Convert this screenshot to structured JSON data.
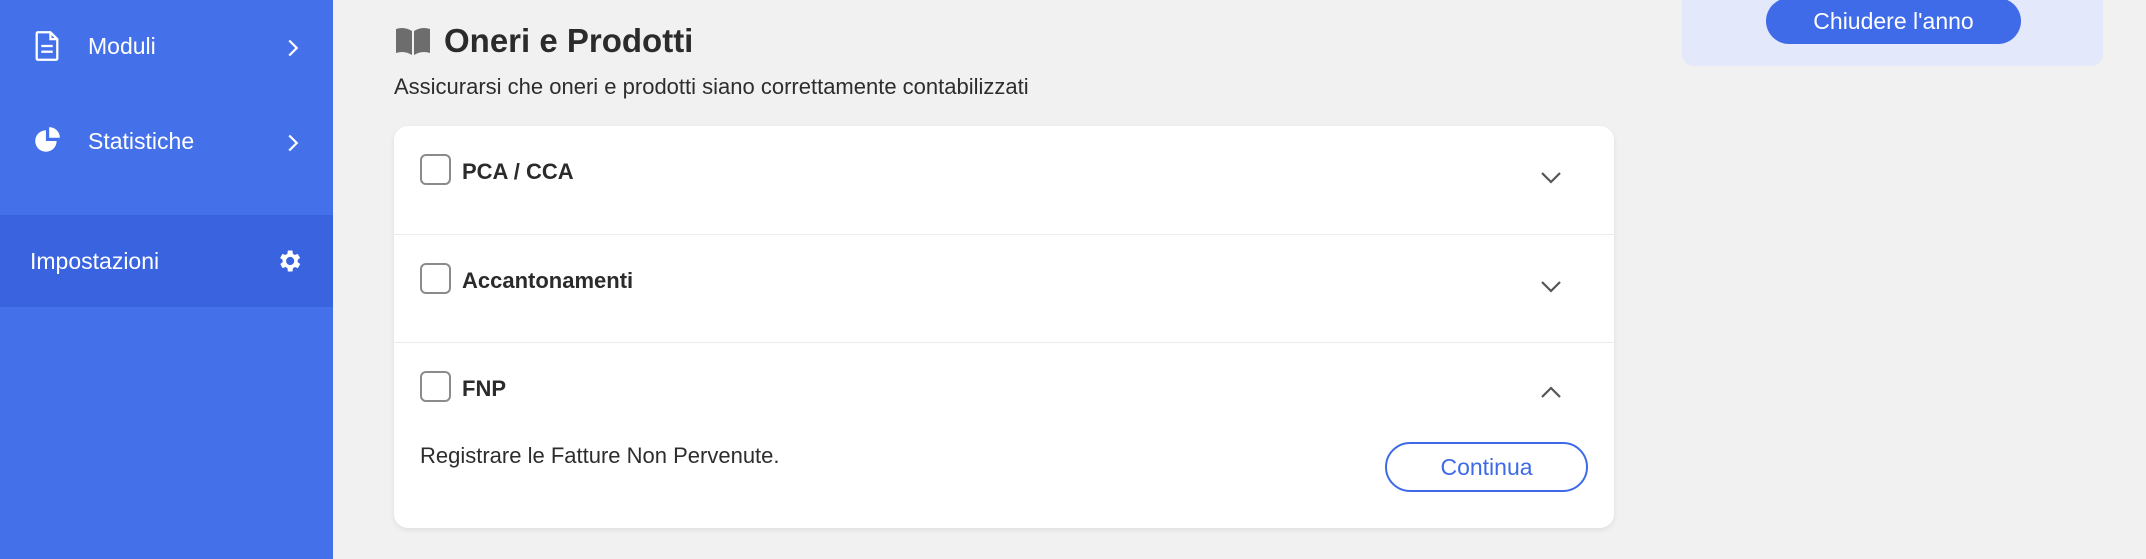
{
  "sidebar": {
    "items": [
      {
        "label": "Moduli",
        "icon": "document-icon"
      },
      {
        "label": "Statistiche",
        "icon": "pie-chart-icon"
      },
      {
        "label": "Impostazioni",
        "icon": "gear-icon"
      }
    ]
  },
  "header": {
    "title": "Oneri e Prodotti",
    "subtitle": "Assicurarsi che oneri e prodotti siano correttamente contabilizzati"
  },
  "checklist": {
    "items": [
      {
        "label": "PCA / CCA",
        "checked": false,
        "expanded": false
      },
      {
        "label": "Accantonamenti",
        "checked": false,
        "expanded": false
      },
      {
        "label": "FNP",
        "checked": false,
        "expanded": true,
        "description": "Registrare le Fatture Non Pervenute.",
        "action_label": "Continua"
      }
    ]
  },
  "right_panel": {
    "close_year_label": "Chiudere l'anno"
  },
  "colors": {
    "sidebar": "#4470ea",
    "sidebar_active": "#3a63e0",
    "accent": "#3f6be8",
    "background": "#f1f1f1",
    "panel": "#e3e8fb"
  }
}
